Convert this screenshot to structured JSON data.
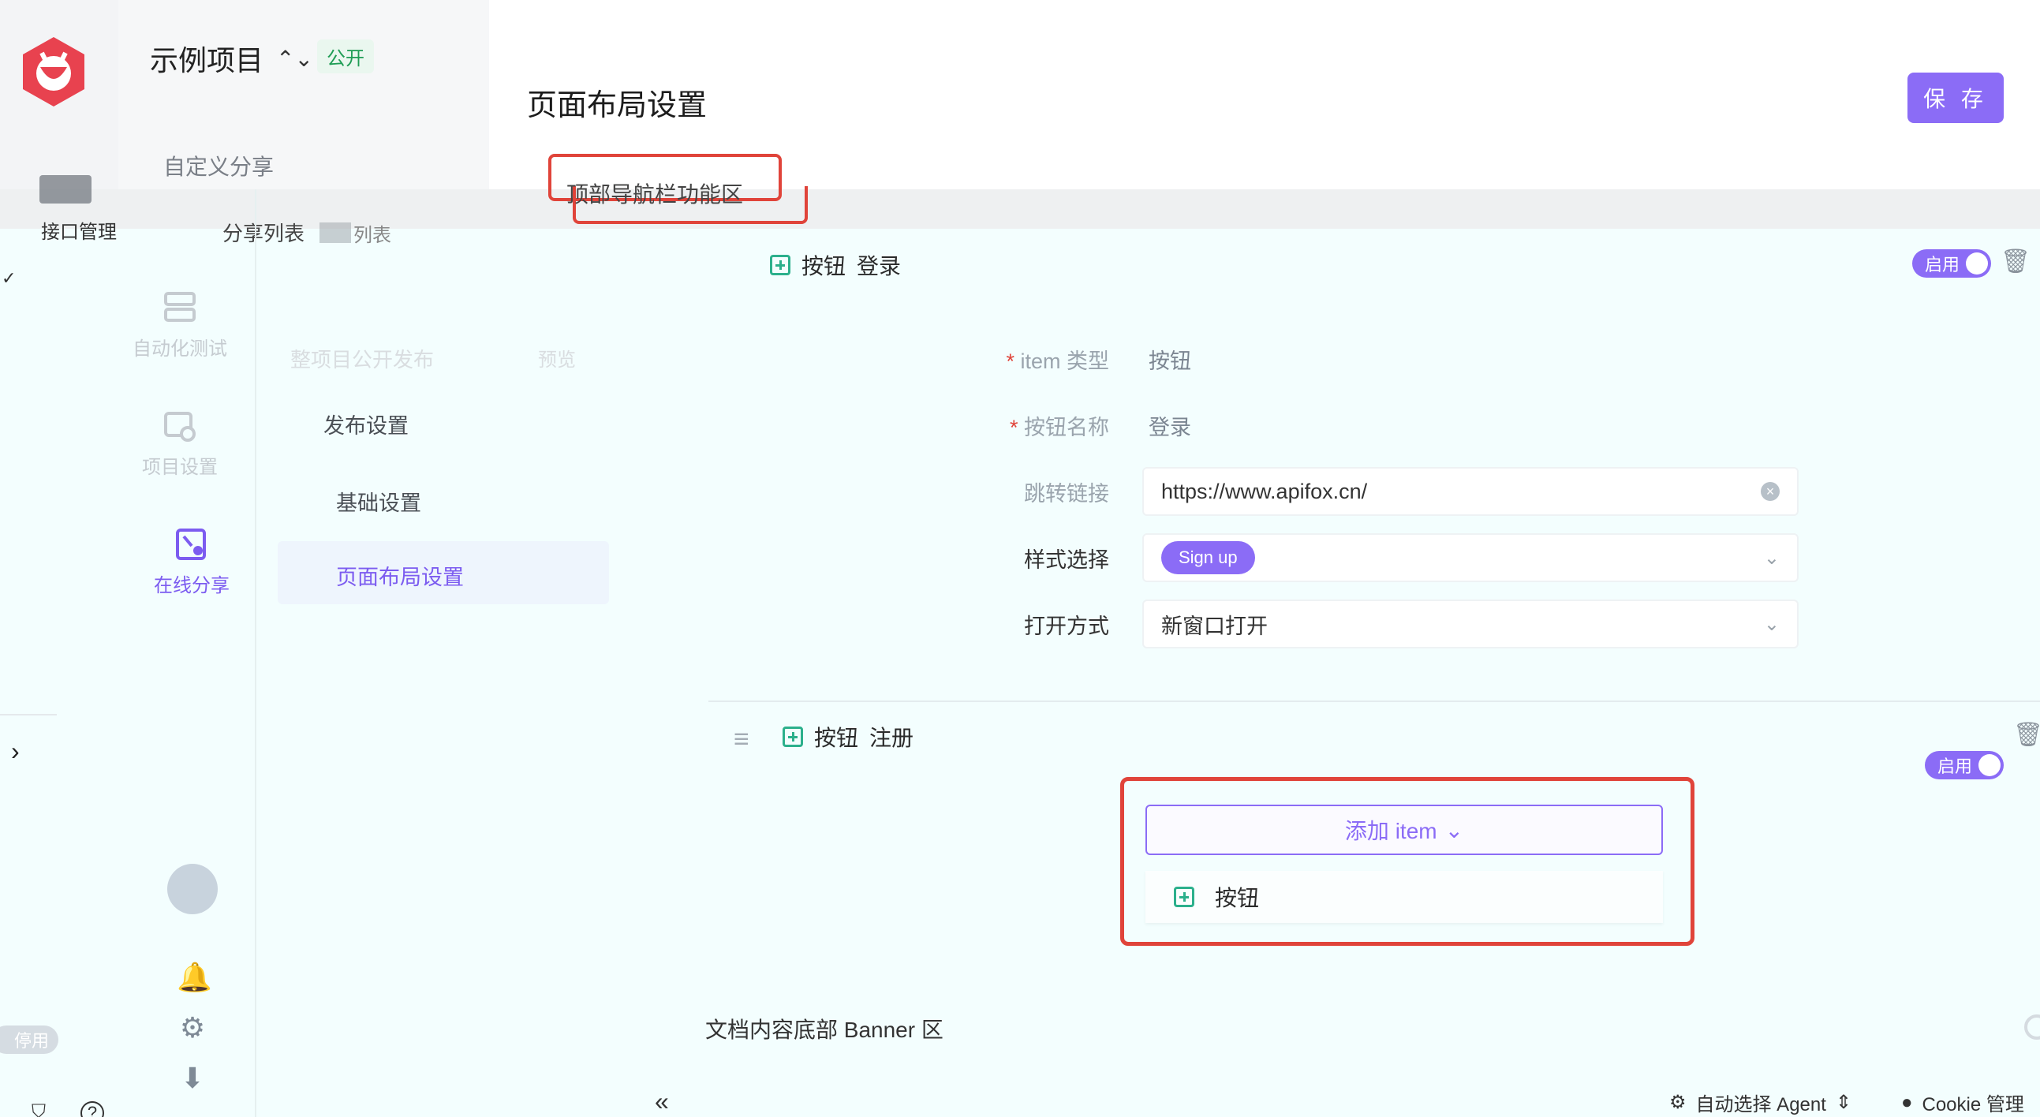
{
  "app": {
    "project_name": "示例项目",
    "visibility": "公开",
    "page_title": "页面布局设置",
    "save_label": "保 存"
  },
  "colors": {
    "accent": "#8b6cf6",
    "highlight": "#e0443a",
    "success": "#2cb08c"
  },
  "top_panel": {
    "custom_share": "自定义分享",
    "strip_text": "顶部导航栏功能区",
    "share_list": "分享列表",
    "list_suffix": "列表"
  },
  "rail": {
    "api_mgmt": "接口管理",
    "auto_test": "自动化测试",
    "project_settings": "项目设置",
    "online_share": "在线分享",
    "status_off": "停用"
  },
  "menu": {
    "publish_all": "整项目公开发布",
    "preview": "预览",
    "publish_settings": "发布设置",
    "basic_settings": "基础设置",
    "layout_settings": "页面布局设置"
  },
  "item1": {
    "type_label": "按钮",
    "name": "登录",
    "enabled_label": "启用",
    "fields": {
      "type_lbl": "item 类型",
      "type_val": "按钮",
      "name_lbl": "按钮名称",
      "name_val": "登录",
      "link_lbl": "跳转链接",
      "link_val": "https://www.apifox.cn/",
      "style_lbl": "样式选择",
      "style_val": "Sign up",
      "open_lbl": "打开方式",
      "open_val": "新窗口打开"
    }
  },
  "item2": {
    "type_label": "按钮",
    "name": "注册",
    "enabled_label": "启用"
  },
  "add_item": {
    "label": "添加 item",
    "option": "按钮"
  },
  "footer": {
    "banner": "文档内容底部 Banner 区",
    "agent": "自动选择 Agent",
    "cookie": "Cookie 管理"
  }
}
